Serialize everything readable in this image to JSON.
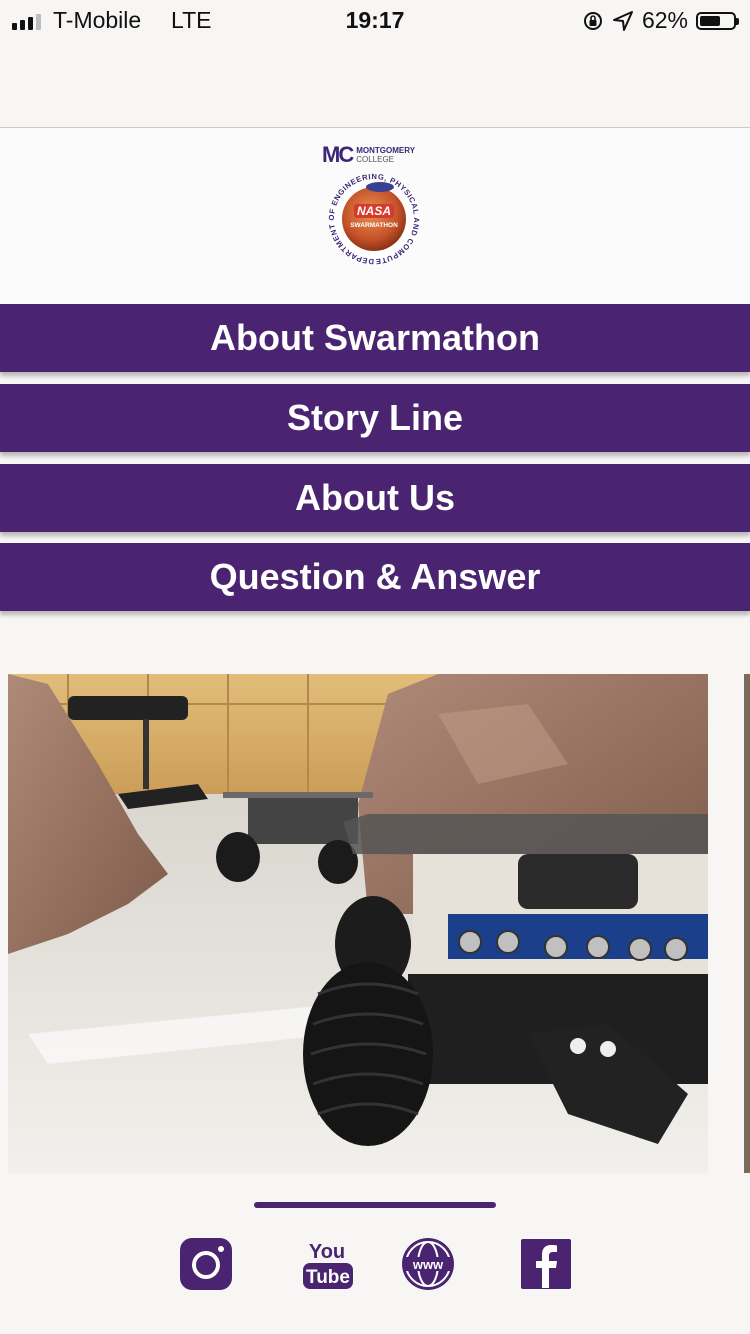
{
  "status_bar": {
    "carrier": "T-Mobile",
    "network": "LTE",
    "time": "19:17",
    "battery": "62%",
    "battery_level": 0.62
  },
  "header": {
    "college_mark": "MC",
    "college_name": "MONTGOMERY",
    "college_sub": "COLLEGE",
    "seal_ring_text": "DEPARTMENT OF ENGINEERING, PHYSICAL AND COMPUTER SCIENCE",
    "seal_center_top": "NASA",
    "seal_center_bottom": "SWARMATHON"
  },
  "nav": {
    "items": [
      {
        "label": "About Swarmathon"
      },
      {
        "label": "Story Line"
      },
      {
        "label": "About Us"
      },
      {
        "label": "Question & Answer"
      }
    ]
  },
  "social": {
    "youtube_top": "You",
    "youtube_bottom": "Tube",
    "web_label": "www"
  },
  "colors": {
    "brand_purple": "#4a2470",
    "background": "#f8f6f4"
  },
  "icons": [
    "instagram-icon",
    "youtube-icon",
    "globe-www-icon",
    "facebook-icon",
    "location-arrow-icon",
    "rotation-lock-icon"
  ]
}
